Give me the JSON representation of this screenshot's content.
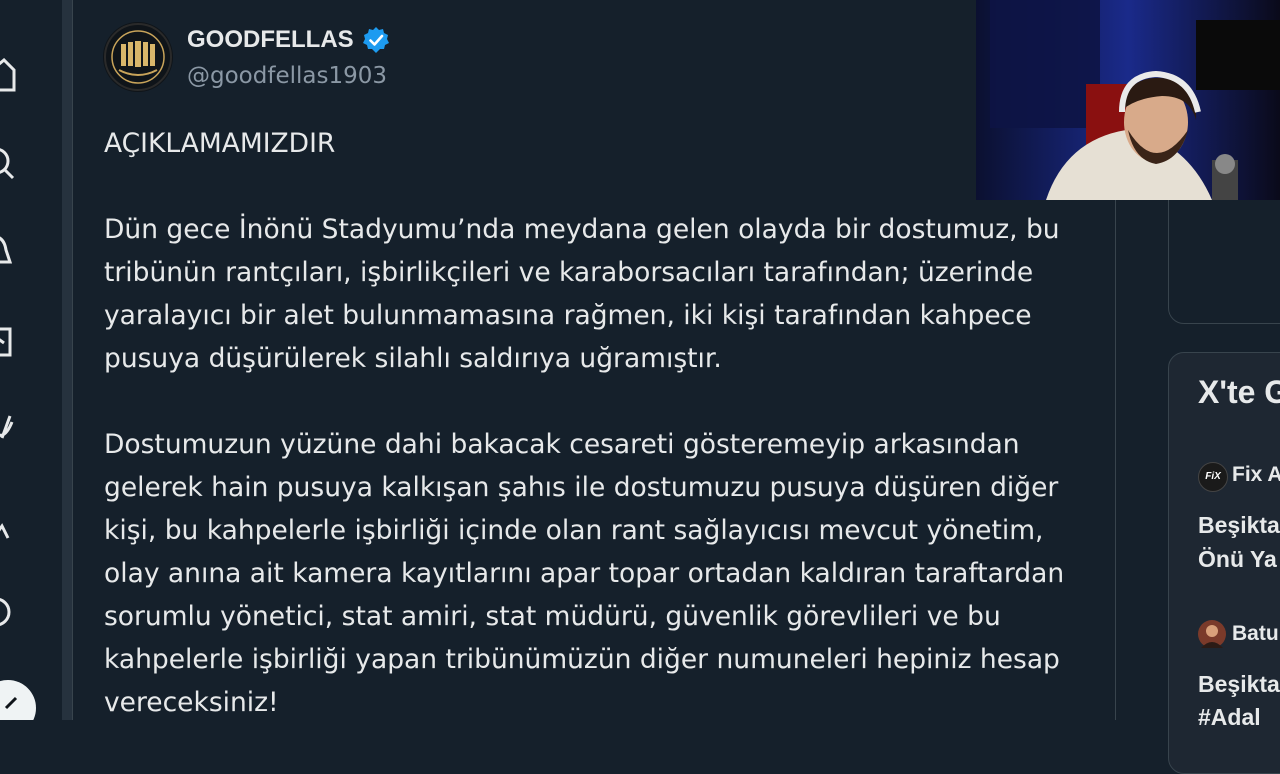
{
  "post": {
    "author_name": "GOODFELLAS",
    "author_handle": "@goodfellas1903",
    "verified": true,
    "paragraphs": [
      "AÇIKLAMAMIZDIR",
      "Dün gece İnönü Stadyumu’nda meydana gelen olayda bir dostumuz, bu tribünün rantçıları, işbirlikçileri ve karaborsacıları tarafından; üzerinde yaralayıcı bir alet bulunmamasına rağmen, iki kişi tarafından kahpece pusuya düşürülerek silahlı saldırıya uğramıştır.",
      "Dostumuzun yüzüne dahi bakacak cesareti gösteremeyip arkasından gelerek hain pusuya kalkışan şahıs ile dostumuzu pusuya düşüren diğer kişi, bu kahpelerle işbirliği içinde olan rant sağlayıcısı mevcut yönetim, olay anına ait kamera kayıtlarını apar topar ortadan kaldıran taraftardan sorumlu yönetici, stat amiri, stat müdürü, güvenlik görevlileri ve bu kahpelerle işbirliği yapan tribünümüzün diğer numuneleri hepiniz hesap vereceksiniz!"
    ]
  },
  "sidebar": {
    "trends_title": "X'te G",
    "items": [
      {
        "user": "Fix A",
        "avatar_text": "FiX",
        "text_lines": [
          "Beşikta",
          "Önü Ya"
        ]
      },
      {
        "user": "Batu",
        "text_lines": [
          "Beşikta",
          "#Adal"
        ]
      }
    ]
  },
  "colors": {
    "background": "#15202b",
    "text": "#e7e9ea",
    "secondary_text": "#8b98a5",
    "verified_blue": "#1d9bf0",
    "border": "#38444d"
  },
  "icons": [
    "home-icon",
    "search-icon",
    "notifications-icon",
    "messages-icon",
    "grok-icon",
    "communities-icon",
    "profile-icon",
    "post-button-icon",
    "verified-badge-icon"
  ]
}
